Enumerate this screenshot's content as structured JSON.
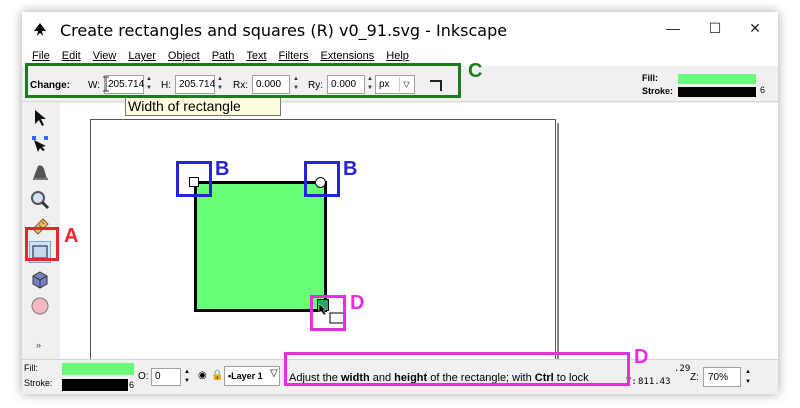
{
  "window": {
    "title": "Create rectangles and squares (R) v0_91.svg - Inkscape",
    "minimize": "—",
    "maximize": "☐",
    "close": "✕"
  },
  "menu": [
    "File",
    "Edit",
    "View",
    "Layer",
    "Object",
    "Path",
    "Text",
    "Filters",
    "Extensions",
    "Help"
  ],
  "controls": {
    "change_label": "Change:",
    "w_label": "W:",
    "w_value": "205.714",
    "h_label": "H:",
    "h_value": "205.714",
    "rx_label": "Rx:",
    "rx_value": "0.000",
    "ry_label": "Ry:",
    "ry_value": "0.000",
    "unit": "px"
  },
  "tooltip": "Width of rectangle",
  "fillstroke_top": {
    "fill_label": "Fill:",
    "stroke_label": "Stroke:",
    "stroke_width": "6",
    "fill_color": "#66ff77",
    "stroke_color": "#000000"
  },
  "annotations": {
    "a": "A",
    "b1": "B",
    "b2": "B",
    "c": "C",
    "d1": "D",
    "d2": "D",
    "red": "#e5282b",
    "blue": "#2424d6",
    "green": "#1d7d1d",
    "magenta": "#e62ee0"
  },
  "statusbar": {
    "fill_label": "Fill:",
    "stroke_label": "Stroke:",
    "stroke_width": "6",
    "opacity_label": "O:",
    "opacity_value": "0",
    "layer": "•Layer 1",
    "message_pre": "Adjust the ",
    "message_bold1": "width",
    "message_mid1": " and ",
    "message_bold2": "height",
    "message_mid2": " of the rectangle; with ",
    "message_bold3": "Ctrl",
    "message_post": " to lock",
    "coord_x": ".29",
    "coord_y": "811.43",
    "y_label": "Y:",
    "zoom_label": "Z:",
    "zoom_value": "70%"
  },
  "tools_expander": "»"
}
